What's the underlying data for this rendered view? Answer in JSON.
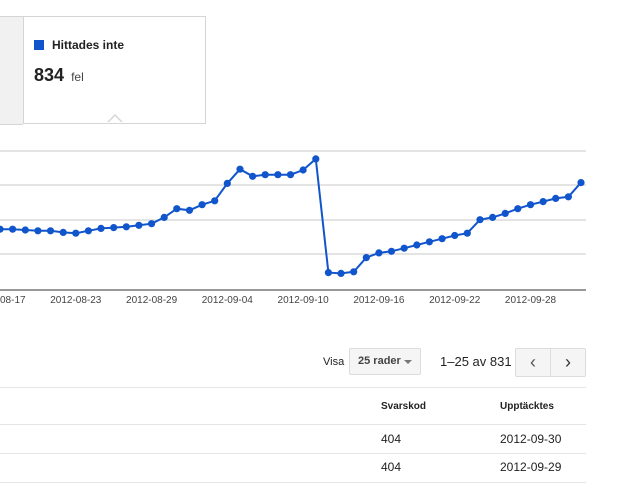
{
  "tooltip": {
    "series_label": "Hittades inte",
    "value": "834",
    "unit": "fel",
    "swatch_color": "#1155cc"
  },
  "chart_data": {
    "type": "line",
    "title": "",
    "xlabel": "",
    "ylabel": "",
    "x_tick_labels": [
      "08-17",
      "2012-08-23",
      "2012-08-29",
      "2012-09-04",
      "2012-09-10",
      "2012-09-16",
      "2012-09-22",
      "2012-09-28"
    ],
    "grid": true,
    "y_axis_labels_visible": false,
    "line_color": "#1155cc",
    "series": [
      {
        "name": "Hittades inte",
        "x": [
          "2012-08-17",
          "2012-08-18",
          "2012-08-19",
          "2012-08-20",
          "2012-08-21",
          "2012-08-22",
          "2012-08-23",
          "2012-08-24",
          "2012-08-25",
          "2012-08-26",
          "2012-08-27",
          "2012-08-28",
          "2012-08-29",
          "2012-08-30",
          "2012-08-31",
          "2012-09-01",
          "2012-09-02",
          "2012-09-03",
          "2012-09-04",
          "2012-09-05",
          "2012-09-06",
          "2012-09-07",
          "2012-09-08",
          "2012-09-09",
          "2012-09-10",
          "2012-09-11",
          "2012-09-12",
          "2012-09-13",
          "2012-09-14",
          "2012-09-15",
          "2012-09-16",
          "2012-09-17",
          "2012-09-18",
          "2012-09-19",
          "2012-09-20",
          "2012-09-21",
          "2012-09-22",
          "2012-09-23",
          "2012-09-24",
          "2012-09-25",
          "2012-09-26",
          "2012-09-27",
          "2012-09-28",
          "2012-09-29",
          "2012-09-30"
        ],
        "values": [
          737,
          737,
          736,
          735,
          735,
          733,
          732,
          735,
          738,
          739,
          740,
          742,
          744,
          752,
          763,
          761,
          768,
          773,
          795,
          813,
          804,
          806,
          806,
          806,
          812,
          826,
          682,
          681,
          683,
          701,
          707,
          709,
          713,
          717,
          721,
          725,
          729,
          732,
          749,
          752,
          757,
          763,
          768,
          772,
          776
        ],
        "comment_after": [
          778,
          796
        ]
      }
    ]
  },
  "pager": {
    "show_label": "Visa",
    "rows_option": "25 rader",
    "range": "1–25 av 831",
    "prev_icon": "‹",
    "next_icon": "›"
  },
  "table": {
    "headers": [
      "Svarskod",
      "Upptäcktes"
    ],
    "rows": [
      [
        "404",
        "2012-09-30"
      ],
      [
        "404",
        "2012-09-29"
      ]
    ]
  }
}
